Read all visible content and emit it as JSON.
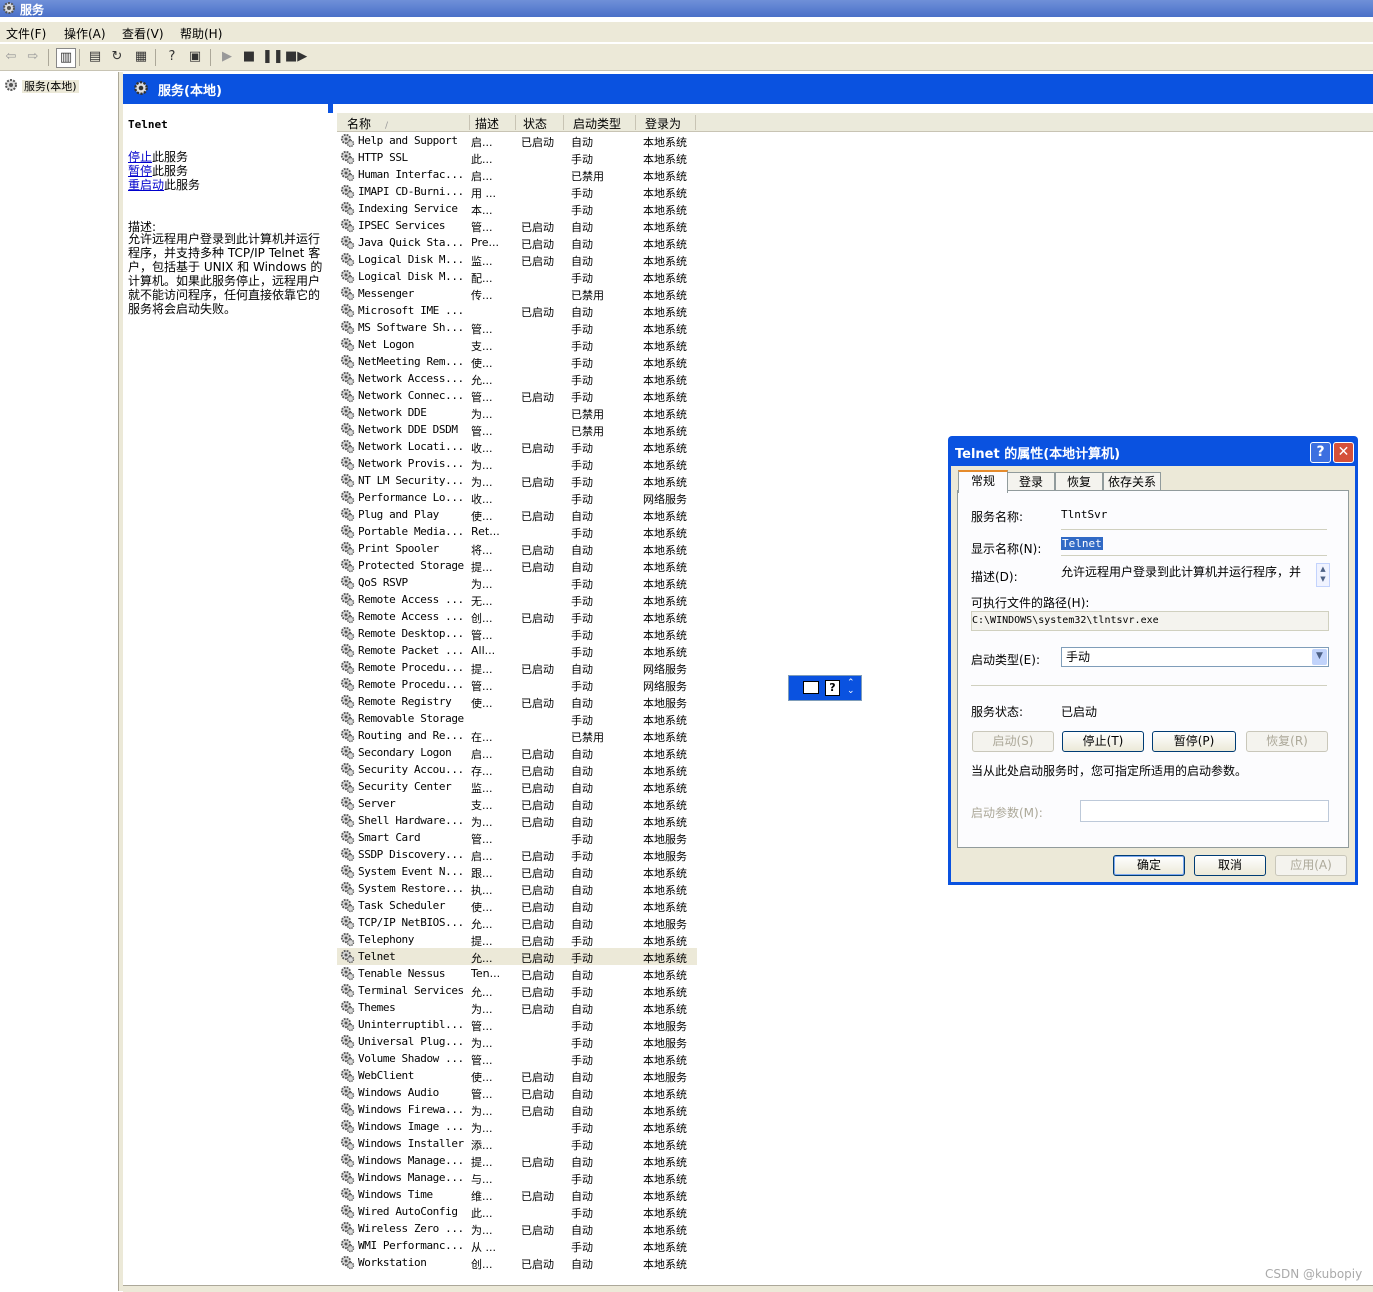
{
  "window": {
    "title": "服务"
  },
  "menu": [
    "文件(F)",
    "操作(A)",
    "查看(V)",
    "帮助(H)"
  ],
  "tree": {
    "root": "服务(本地)"
  },
  "header": {
    "title": "服务(本地)"
  },
  "detail": {
    "service_name": "Telnet",
    "actions": [
      {
        "link": "停止",
        "suffix": "此服务"
      },
      {
        "link": "暂停",
        "suffix": "此服务"
      },
      {
        "link": "重启动",
        "suffix": "此服务"
      }
    ],
    "desc_label": "描述:",
    "description": "允许远程用户登录到此计算机并运行程序，并支持多种 TCP/IP Telnet 客户，包括基于 UNIX 和 Windows 的计算机。如果此服务停止，远程用户就不能访问程序，任何直接依靠它的服务将会启动失败。"
  },
  "columns": [
    "名称",
    "描述",
    "状态",
    "启动类型",
    "登录为"
  ],
  "services": [
    [
      "Help and Support",
      "启...",
      "已启动",
      "自动",
      "本地系统"
    ],
    [
      "HTTP SSL",
      "此...",
      "",
      "手动",
      "本地系统"
    ],
    [
      "Human Interfac...",
      "启...",
      "",
      "已禁用",
      "本地系统"
    ],
    [
      "IMAPI CD-Burni...",
      "用 ...",
      "",
      "手动",
      "本地系统"
    ],
    [
      "Indexing Service",
      "本...",
      "",
      "手动",
      "本地系统"
    ],
    [
      "IPSEC Services",
      "管...",
      "已启动",
      "自动",
      "本地系统"
    ],
    [
      "Java Quick Sta...",
      "Pre...",
      "已启动",
      "自动",
      "本地系统"
    ],
    [
      "Logical Disk M...",
      "监...",
      "已启动",
      "自动",
      "本地系统"
    ],
    [
      "Logical Disk M...",
      "配...",
      "",
      "手动",
      "本地系统"
    ],
    [
      "Messenger",
      "传...",
      "",
      "已禁用",
      "本地系统"
    ],
    [
      "Microsoft IME ...",
      "",
      "已启动",
      "自动",
      "本地系统"
    ],
    [
      "MS Software Sh...",
      "管...",
      "",
      "手动",
      "本地系统"
    ],
    [
      "Net Logon",
      "支...",
      "",
      "手动",
      "本地系统"
    ],
    [
      "NetMeeting Rem...",
      "使...",
      "",
      "手动",
      "本地系统"
    ],
    [
      "Network Access...",
      "允...",
      "",
      "手动",
      "本地系统"
    ],
    [
      "Network Connec...",
      "管...",
      "已启动",
      "手动",
      "本地系统"
    ],
    [
      "Network DDE",
      "为...",
      "",
      "已禁用",
      "本地系统"
    ],
    [
      "Network DDE DSDM",
      "管...",
      "",
      "已禁用",
      "本地系统"
    ],
    [
      "Network Locati...",
      "收...",
      "已启动",
      "手动",
      "本地系统"
    ],
    [
      "Network Provis...",
      "为...",
      "",
      "手动",
      "本地系统"
    ],
    [
      "NT LM Security...",
      "为...",
      "已启动",
      "手动",
      "本地系统"
    ],
    [
      "Performance Lo...",
      "收...",
      "",
      "手动",
      "网络服务"
    ],
    [
      "Plug and Play",
      "使...",
      "已启动",
      "自动",
      "本地系统"
    ],
    [
      "Portable Media...",
      "Ret...",
      "",
      "手动",
      "本地系统"
    ],
    [
      "Print Spooler",
      "将...",
      "已启动",
      "自动",
      "本地系统"
    ],
    [
      "Protected Storage",
      "提...",
      "已启动",
      "自动",
      "本地系统"
    ],
    [
      "QoS RSVP",
      "为...",
      "",
      "手动",
      "本地系统"
    ],
    [
      "Remote Access ...",
      "无...",
      "",
      "手动",
      "本地系统"
    ],
    [
      "Remote Access ...",
      "创...",
      "已启动",
      "手动",
      "本地系统"
    ],
    [
      "Remote Desktop...",
      "管...",
      "",
      "手动",
      "本地系统"
    ],
    [
      "Remote Packet ...",
      "All...",
      "",
      "手动",
      "本地系统"
    ],
    [
      "Remote Procedu...",
      "提...",
      "已启动",
      "自动",
      "网络服务"
    ],
    [
      "Remote Procedu...",
      "管...",
      "",
      "手动",
      "网络服务"
    ],
    [
      "Remote Registry",
      "使...",
      "已启动",
      "自动",
      "本地服务"
    ],
    [
      "Removable Storage",
      "",
      "",
      "手动",
      "本地系统"
    ],
    [
      "Routing and Re...",
      "在...",
      "",
      "已禁用",
      "本地系统"
    ],
    [
      "Secondary Logon",
      "启...",
      "已启动",
      "自动",
      "本地系统"
    ],
    [
      "Security Accou...",
      "存...",
      "已启动",
      "自动",
      "本地系统"
    ],
    [
      "Security Center",
      "监...",
      "已启动",
      "自动",
      "本地系统"
    ],
    [
      "Server",
      "支...",
      "已启动",
      "自动",
      "本地系统"
    ],
    [
      "Shell Hardware...",
      "为...",
      "已启动",
      "自动",
      "本地系统"
    ],
    [
      "Smart Card",
      "管...",
      "",
      "手动",
      "本地服务"
    ],
    [
      "SSDP Discovery...",
      "启...",
      "已启动",
      "手动",
      "本地服务"
    ],
    [
      "System Event N...",
      "跟...",
      "已启动",
      "自动",
      "本地系统"
    ],
    [
      "System Restore...",
      "执...",
      "已启动",
      "自动",
      "本地系统"
    ],
    [
      "Task Scheduler",
      "使...",
      "已启动",
      "自动",
      "本地系统"
    ],
    [
      "TCP/IP NetBIOS...",
      "允...",
      "已启动",
      "自动",
      "本地服务"
    ],
    [
      "Telephony",
      "提...",
      "已启动",
      "手动",
      "本地系统"
    ],
    [
      "Telnet",
      "允...",
      "已启动",
      "手动",
      "本地系统"
    ],
    [
      "Tenable Nessus",
      "Ten...",
      "已启动",
      "自动",
      "本地系统"
    ],
    [
      "Terminal Services",
      "允...",
      "已启动",
      "手动",
      "本地系统"
    ],
    [
      "Themes",
      "为...",
      "已启动",
      "自动",
      "本地系统"
    ],
    [
      "Uninterruptibl...",
      "管...",
      "",
      "手动",
      "本地服务"
    ],
    [
      "Universal Plug...",
      "为...",
      "",
      "手动",
      "本地服务"
    ],
    [
      "Volume Shadow ...",
      "管...",
      "",
      "手动",
      "本地系统"
    ],
    [
      "WebClient",
      "使...",
      "已启动",
      "自动",
      "本地服务"
    ],
    [
      "Windows Audio",
      "管...",
      "已启动",
      "自动",
      "本地系统"
    ],
    [
      "Windows Firewa...",
      "为...",
      "已启动",
      "自动",
      "本地系统"
    ],
    [
      "Windows Image ...",
      "为...",
      "",
      "手动",
      "本地系统"
    ],
    [
      "Windows Installer",
      "添...",
      "",
      "手动",
      "本地系统"
    ],
    [
      "Windows Manage...",
      "提...",
      "已启动",
      "自动",
      "本地系统"
    ],
    [
      "Windows Manage...",
      "与...",
      "",
      "手动",
      "本地系统"
    ],
    [
      "Windows Time",
      "维...",
      "已启动",
      "自动",
      "本地系统"
    ],
    [
      "Wired AutoConfig",
      "此...",
      "",
      "手动",
      "本地系统"
    ],
    [
      "Wireless Zero ...",
      "为...",
      "已启动",
      "自动",
      "本地系统"
    ],
    [
      "WMI Performanc...",
      "从 ...",
      "",
      "手动",
      "本地系统"
    ],
    [
      "Workstation",
      "创...",
      "已启动",
      "自动",
      "本地系统"
    ]
  ],
  "selected_service": "Telnet",
  "dialog": {
    "title": "Telnet 的属性(本地计算机)",
    "help_label": "?",
    "close_label": "✕",
    "tabs": [
      "常规",
      "登录",
      "恢复",
      "依存关系"
    ],
    "service_name_label": "服务名称:",
    "service_name": "TlntSvr",
    "display_name_label": "显示名称(N):",
    "display_name": "Telnet",
    "description_label": "描述(D):",
    "description": "允许远程用户登录到此计算机并运行程序，并",
    "path_label": "可执行文件的路径(H):",
    "path": "C:\\WINDOWS\\system32\\tlntsvr.exe",
    "startup_type_label": "启动类型(E):",
    "startup_type": "手动",
    "status_label": "服务状态:",
    "status": "已启动",
    "btn_start": "启动(S)",
    "btn_stop": "停止(T)",
    "btn_pause": "暂停(P)",
    "btn_resume": "恢复(R)",
    "hint": "当从此处启动服务时，您可指定所适用的启动参数。",
    "param_label": "启动参数(M):",
    "param_value": "",
    "btn_ok": "确定",
    "btn_cancel": "取消",
    "btn_apply": "应用(A)"
  },
  "watermark": "CSDN @kubopiy",
  "colors": {
    "header_blue": "#0a52e0",
    "selection": "#ece9d8",
    "link": "#0000cc"
  }
}
